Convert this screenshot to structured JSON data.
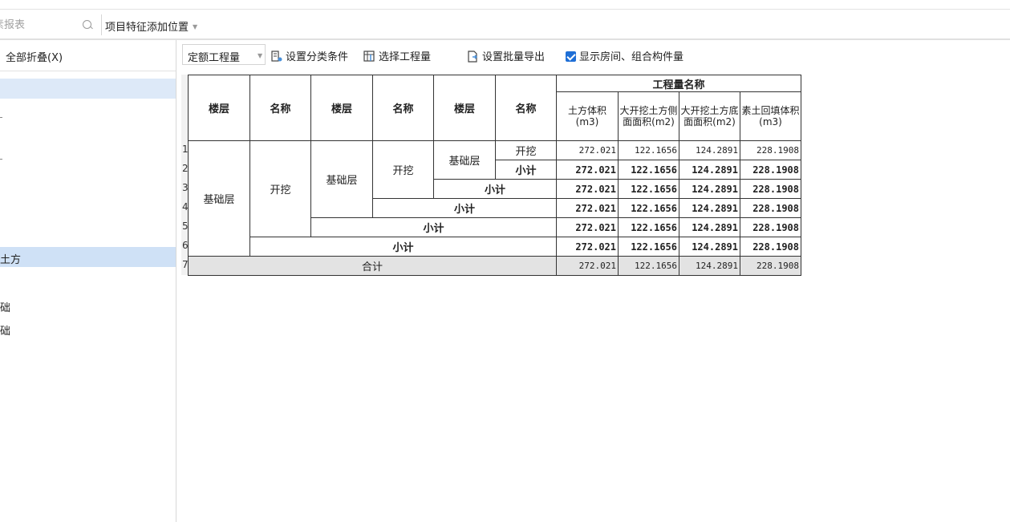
{
  "topbar": {
    "search_placeholder": "素报表",
    "search_icon": "search-icon",
    "project_position": "项目特征添加位置"
  },
  "left_panel": {
    "collapse_label": "全部折叠(X)",
    "tree": [
      {
        "label": "土方"
      },
      {
        "label": "础"
      },
      {
        "label": "础"
      }
    ]
  },
  "toolbar": {
    "quantity_type": "定额工程量",
    "set_classification": "设置分类条件",
    "select_quantity": "选择工程量",
    "set_batch_export": "设置批量导出",
    "show_rooms": "显示房间、组合构件量",
    "show_rooms_checked": true
  },
  "report": {
    "row_numbers": [
      "1",
      "2",
      "3",
      "4",
      "5",
      "6",
      "7"
    ],
    "headers": {
      "floor1": "楼层",
      "name1": "名称",
      "floor2": "楼层",
      "name2": "名称",
      "floor3": "楼层",
      "name3": "名称",
      "quantity_name": "工程量名称",
      "col1": "土方体积(m3)",
      "col2": "大开挖土方侧面面积(m2)",
      "col3": "大开挖土方底面面积(m2)",
      "col4": "素土回填体积(m3)"
    },
    "floor_a": "基础层",
    "name_a": "开挖",
    "floor_b": "基础层",
    "name_b": "开挖",
    "floor_c": "基础层",
    "name_c": "开挖",
    "subtotal": "小计",
    "total": "合计",
    "rows": [
      [
        "272.021",
        "122.1656",
        "124.2891",
        "228.1908"
      ],
      [
        "272.021",
        "122.1656",
        "124.2891",
        "228.1908"
      ],
      [
        "272.021",
        "122.1656",
        "124.2891",
        "228.1908"
      ],
      [
        "272.021",
        "122.1656",
        "124.2891",
        "228.1908"
      ],
      [
        "272.021",
        "122.1656",
        "124.2891",
        "228.1908"
      ],
      [
        "272.021",
        "122.1656",
        "124.2891",
        "228.1908"
      ],
      [
        "272.021",
        "122.1656",
        "124.2891",
        "228.1908"
      ]
    ]
  }
}
